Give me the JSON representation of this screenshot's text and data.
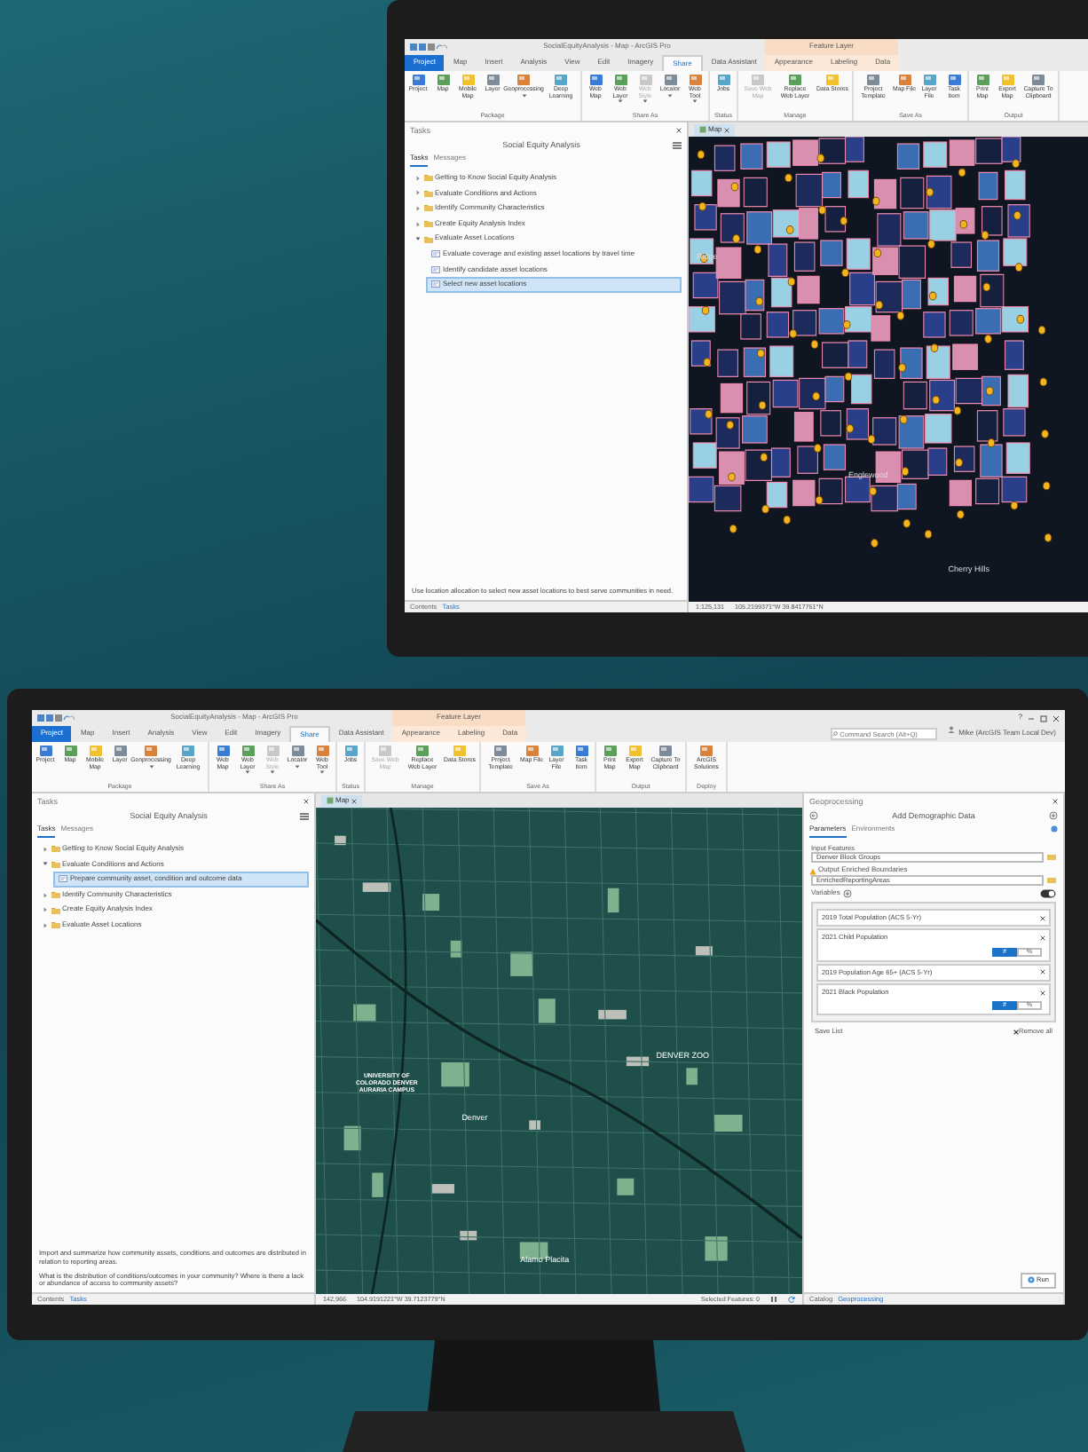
{
  "monitors": [
    {
      "window": {
        "title": "SocialEquityAnalysis - Map - ArcGIS Pro",
        "context_group": "Feature Layer"
      },
      "ribbon_tabs": [
        {
          "label": "Project",
          "kind": "file",
          "selected": false
        },
        {
          "label": "Map",
          "kind": "main",
          "selected": false
        },
        {
          "label": "Insert",
          "kind": "main",
          "selected": false
        },
        {
          "label": "Analysis",
          "kind": "main",
          "selected": false
        },
        {
          "label": "View",
          "kind": "main",
          "selected": false
        },
        {
          "label": "Edit",
          "kind": "main",
          "selected": false
        },
        {
          "label": "Imagery",
          "kind": "main",
          "selected": false
        },
        {
          "label": "Share",
          "kind": "main",
          "selected": true
        },
        {
          "label": "Data Assistant",
          "kind": "main",
          "selected": false
        },
        {
          "label": "Appearance",
          "kind": "context",
          "selected": false
        },
        {
          "label": "Labeling",
          "kind": "context",
          "selected": false
        },
        {
          "label": "Data",
          "kind": "context",
          "selected": false
        }
      ],
      "ribbon_groups": [
        {
          "label": "Package",
          "buttons": [
            {
              "label": "Project",
              "disabled": false,
              "dropdown": false
            },
            {
              "label": "Map",
              "disabled": false,
              "dropdown": false
            },
            {
              "label": "Mobile Map",
              "disabled": false,
              "dropdown": false
            },
            {
              "label": "Layer",
              "disabled": false,
              "dropdown": false
            },
            {
              "label": "Geoprocessing",
              "disabled": false,
              "dropdown": true
            },
            {
              "label": "Deep Learning",
              "disabled": false,
              "dropdown": false
            }
          ]
        },
        {
          "label": "Share As",
          "buttons": [
            {
              "label": "Web Map",
              "disabled": false,
              "dropdown": false
            },
            {
              "label": "Web Layer",
              "disabled": false,
              "dropdown": true
            },
            {
              "label": "Web Style",
              "disabled": true,
              "dropdown": true
            },
            {
              "label": "Locator",
              "disabled": false,
              "dropdown": true
            },
            {
              "label": "Web Tool",
              "disabled": false,
              "dropdown": true
            }
          ]
        },
        {
          "label": "Status",
          "buttons": [
            {
              "label": "Jobs",
              "disabled": false,
              "dropdown": false
            }
          ]
        },
        {
          "label": "Manage",
          "buttons": [
            {
              "label": "Save Web Map",
              "disabled": true,
              "dropdown": false
            },
            {
              "label": "Replace Web Layer",
              "disabled": false,
              "dropdown": false
            },
            {
              "label": "Data Stores",
              "disabled": false,
              "dropdown": false
            }
          ]
        },
        {
          "label": "Save As",
          "buttons": [
            {
              "label": "Project Template",
              "disabled": false,
              "dropdown": false
            },
            {
              "label": "Map File",
              "disabled": false,
              "dropdown": false
            },
            {
              "label": "Layer File",
              "disabled": false,
              "dropdown": false
            },
            {
              "label": "Task Item",
              "disabled": false,
              "dropdown": false
            }
          ]
        },
        {
          "label": "Output",
          "buttons": [
            {
              "label": "Print Map",
              "disabled": false,
              "dropdown": false
            },
            {
              "label": "Export Map",
              "disabled": false,
              "dropdown": false
            },
            {
              "label": "Capture To Clipboard",
              "disabled": false,
              "dropdown": false
            }
          ]
        }
      ],
      "tasks_pane": {
        "header": "Tasks",
        "title": "Social Equity Analysis",
        "tabs": [
          {
            "label": "Tasks",
            "selected": true
          },
          {
            "label": "Messages",
            "selected": false
          }
        ],
        "items": [
          {
            "label": "Getting to Know Social Equity Analysis",
            "expanded": false
          },
          {
            "label": "Evaluate Conditions and Actions",
            "expanded": false
          },
          {
            "label": "Identify Community Characteristics",
            "expanded": false
          },
          {
            "label": "Create Equity Analysis Index",
            "expanded": false
          },
          {
            "label": "Evaluate Asset Locations",
            "expanded": true,
            "children": [
              {
                "label": "Evaluate coverage and existing asset locations by travel time",
                "selected": false
              },
              {
                "label": "Identify candidate asset locations",
                "selected": false
              },
              {
                "label": "Select new asset locations",
                "selected": true
              }
            ]
          }
        ],
        "description": [
          "Use location allocation to select new asset locations to best serve communities in need."
        ],
        "bottom_tabs": [
          {
            "label": "Contents",
            "selected": false
          },
          {
            "label": "Tasks",
            "selected": true
          }
        ]
      },
      "map": {
        "tab": "Map",
        "kind": "choropleth",
        "labels": [
          "Ridge",
          "Englewood",
          "Cherry Hills"
        ]
      },
      "status_bar": {
        "scale": "1:125,131",
        "coordinates": "105.2199371°W 39.8417761°N"
      }
    },
    {
      "window": {
        "title": "SocialEquityAnalysis - Map - ArcGIS Pro",
        "context_group": "Feature Layer",
        "help": "?"
      },
      "ribbon_tabs": [
        {
          "label": "Project",
          "kind": "file",
          "selected": false
        },
        {
          "label": "Map",
          "kind": "main",
          "selected": false
        },
        {
          "label": "Insert",
          "kind": "main",
          "selected": false
        },
        {
          "label": "Analysis",
          "kind": "main",
          "selected": false
        },
        {
          "label": "View",
          "kind": "main",
          "selected": false
        },
        {
          "label": "Edit",
          "kind": "main",
          "selected": false
        },
        {
          "label": "Imagery",
          "kind": "main",
          "selected": false
        },
        {
          "label": "Share",
          "kind": "main",
          "selected": true
        },
        {
          "label": "Data Assistant",
          "kind": "main",
          "selected": false
        },
        {
          "label": "Appearance",
          "kind": "context",
          "selected": false
        },
        {
          "label": "Labeling",
          "kind": "context",
          "selected": false
        },
        {
          "label": "Data",
          "kind": "context",
          "selected": false
        }
      ],
      "search": {
        "placeholder": "Command Search (Alt+Q)"
      },
      "user": "Mike (ArcGIS Team Local Dev)",
      "ribbon_groups": [
        {
          "label": "Package",
          "buttons": [
            {
              "label": "Project",
              "disabled": false,
              "dropdown": false
            },
            {
              "label": "Map",
              "disabled": false,
              "dropdown": false
            },
            {
              "label": "Mobile Map",
              "disabled": false,
              "dropdown": false
            },
            {
              "label": "Layer",
              "disabled": false,
              "dropdown": false
            },
            {
              "label": "Geoprocessing",
              "disabled": false,
              "dropdown": true
            },
            {
              "label": "Deep Learning",
              "disabled": false,
              "dropdown": false
            }
          ]
        },
        {
          "label": "Share As",
          "buttons": [
            {
              "label": "Web Map",
              "disabled": false,
              "dropdown": false
            },
            {
              "label": "Web Layer",
              "disabled": false,
              "dropdown": true
            },
            {
              "label": "Web Style",
              "disabled": true,
              "dropdown": true
            },
            {
              "label": "Locator",
              "disabled": false,
              "dropdown": true
            },
            {
              "label": "Web Tool",
              "disabled": false,
              "dropdown": true
            }
          ]
        },
        {
          "label": "Status",
          "buttons": [
            {
              "label": "Jobs",
              "disabled": false,
              "dropdown": false
            }
          ]
        },
        {
          "label": "Manage",
          "buttons": [
            {
              "label": "Save Web Map",
              "disabled": true,
              "dropdown": false
            },
            {
              "label": "Replace Web Layer",
              "disabled": false,
              "dropdown": false
            },
            {
              "label": "Data Stores",
              "disabled": false,
              "dropdown": false
            }
          ]
        },
        {
          "label": "Save As",
          "buttons": [
            {
              "label": "Project Template",
              "disabled": false,
              "dropdown": false
            },
            {
              "label": "Map File",
              "disabled": false,
              "dropdown": false
            },
            {
              "label": "Layer File",
              "disabled": false,
              "dropdown": false
            },
            {
              "label": "Task Item",
              "disabled": false,
              "dropdown": false
            }
          ]
        },
        {
          "label": "Output",
          "buttons": [
            {
              "label": "Print Map",
              "disabled": false,
              "dropdown": false
            },
            {
              "label": "Export Map",
              "disabled": false,
              "dropdown": false
            },
            {
              "label": "Capture To Clipboard",
              "disabled": false,
              "dropdown": false
            }
          ]
        },
        {
          "label": "Deploy",
          "buttons": [
            {
              "label": "ArcGIS Solutions",
              "disabled": false,
              "dropdown": false
            }
          ]
        }
      ],
      "tasks_pane": {
        "header": "Tasks",
        "title": "Social Equity Analysis",
        "tabs": [
          {
            "label": "Tasks",
            "selected": true
          },
          {
            "label": "Messages",
            "selected": false
          }
        ],
        "items": [
          {
            "label": "Getting to Know Social Equity Analysis",
            "expanded": false
          },
          {
            "label": "Evaluate Conditions and Actions",
            "expanded": true,
            "children": [
              {
                "label": "Prepare community asset, condition and outcome data",
                "selected": true
              }
            ]
          },
          {
            "label": "Identify Community Characteristics",
            "expanded": false
          },
          {
            "label": "Create Equity Analysis Index",
            "expanded": false
          },
          {
            "label": "Evaluate Asset Locations",
            "expanded": false
          }
        ],
        "description": [
          "Import and summarize how community assets, conditions and outcomes are distributed in relation to reporting areas.",
          "What is the distribution of conditions/outcomes in your community? Where is there a lack or abundance of access to community assets?"
        ],
        "bottom_tabs": [
          {
            "label": "Contents",
            "selected": false
          },
          {
            "label": "Tasks",
            "selected": true
          }
        ]
      },
      "map": {
        "tab": "Map",
        "kind": "basemap",
        "labels": [
          "UNIVERSITY OF COLORADO DENVER AURARIA CAMPUS",
          "DENVER ZOO",
          "Denver",
          "Alamo Placita"
        ]
      },
      "status_bar": {
        "scale": "142,966",
        "coordinates": "104.9191221°W 39.7123779°N",
        "selected_features": "Selected Features: 0"
      },
      "geoprocessing": {
        "header": "Geoprocessing",
        "title": "Add Demographic Data",
        "tabs": [
          {
            "label": "Parameters",
            "selected": true
          },
          {
            "label": "Environments",
            "selected": false
          }
        ],
        "input_label": "Input Features",
        "input_value": "Denver Block Groups",
        "output_label": "Output Enriched Boundaries",
        "output_value": "EnrichedReportingAreas",
        "output_warning": true,
        "variables_label": "Variables",
        "variables_toggle_on": true,
        "variables": [
          {
            "label": "2019 Total Population (ACS 5-Yr)",
            "kind": "plain"
          },
          {
            "label": "2021 Child Population",
            "kind": "units",
            "options": [
              {
                "label": "#",
                "selected": true
              },
              {
                "label": "%",
                "selected": false
              }
            ]
          },
          {
            "label": "2019 Population Age 65+ (ACS 5-Yr)",
            "kind": "plain"
          },
          {
            "label": "2021 Black Population",
            "kind": "units",
            "options": [
              {
                "label": "#",
                "selected": true
              },
              {
                "label": "%",
                "selected": false
              }
            ]
          }
        ],
        "save_list": "Save List",
        "remove_all": "Remove all",
        "run": "Run",
        "bottom_tabs": [
          {
            "label": "Catalog",
            "selected": false
          },
          {
            "label": "Geoprocessing",
            "selected": true
          }
        ]
      }
    }
  ]
}
